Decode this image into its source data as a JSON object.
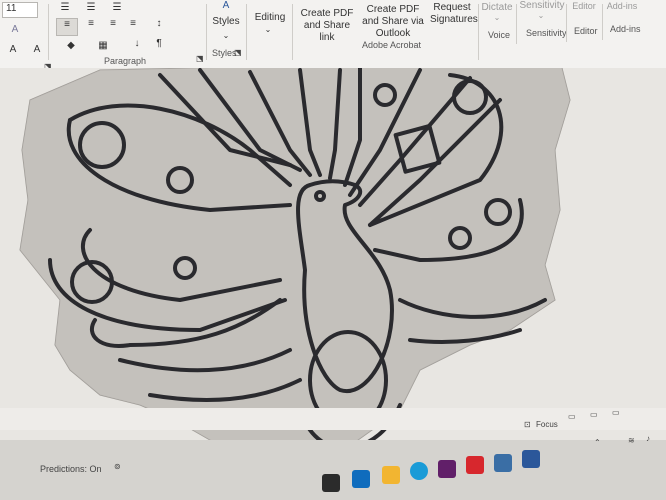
{
  "ribbon": {
    "font_size": "11",
    "paragraph_label": "Paragraph",
    "styles_label": "Styles",
    "styles_group_label": "Styles",
    "editing_label": "Editing",
    "create_pdf_share_link": "Create PDF and Share link",
    "create_pdf_share_outlook": "Create PDF and Share via Outlook",
    "request_signatures": "Request Signatures",
    "adobe_acrobat_label": "Adobe Acrobat",
    "dictate_label": "Dictate",
    "voice_label": "Voice",
    "sensitivity_label": "Sensitivity",
    "sensitivity_group_label": "Sensitivity",
    "editor_label": "Editor",
    "editor_group_label": "Editor",
    "addins_label": "Add-ins",
    "addins_group_label": "Add-ins"
  },
  "status": {
    "focus_label": "Focus",
    "predictions_label": "Predictions: On"
  },
  "colors": {
    "ribbon_bg": "#f3f2f0",
    "paper": "#bdbab5",
    "ink": "#2a2a2e"
  }
}
